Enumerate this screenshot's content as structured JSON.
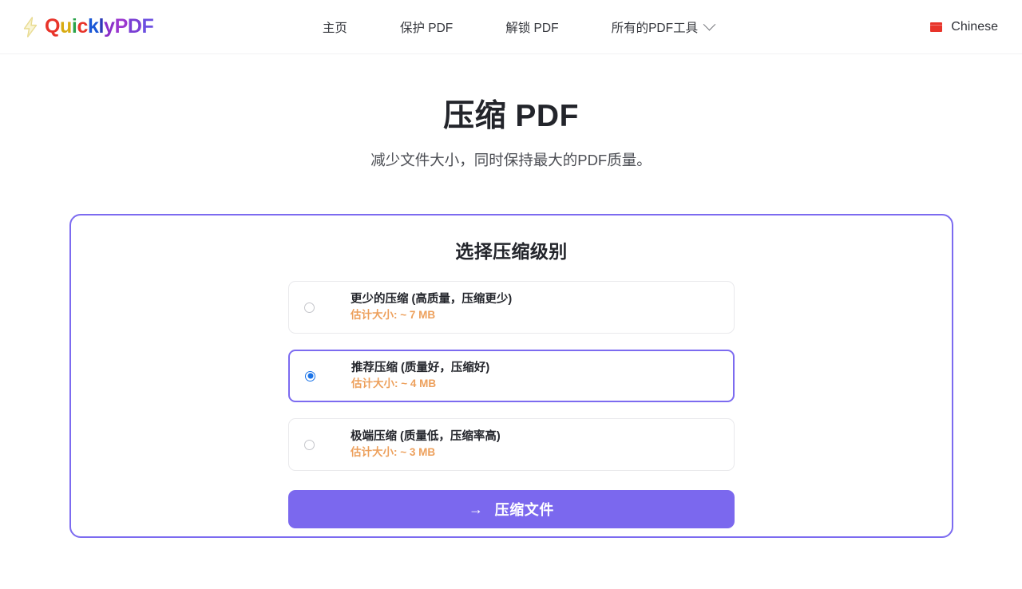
{
  "header": {
    "brand": {
      "icon": "lightning-bolt-icon",
      "letters": [
        {
          "ch": "Q",
          "cls": "l-q"
        },
        {
          "ch": "u",
          "cls": "l-u"
        },
        {
          "ch": "i",
          "cls": "l-i"
        },
        {
          "ch": "c",
          "cls": "l-c"
        },
        {
          "ch": "k",
          "cls": "l-k"
        },
        {
          "ch": "l",
          "cls": "l-l"
        },
        {
          "ch": "y",
          "cls": "l-y"
        },
        {
          "ch": "P",
          "cls": "l-p"
        },
        {
          "ch": "D",
          "cls": "l-d"
        },
        {
          "ch": "F",
          "cls": "l-f"
        }
      ],
      "full_text": "QuicklyPDF"
    },
    "nav": [
      {
        "label": "主页",
        "has_chevron": false
      },
      {
        "label": "保护 PDF",
        "has_chevron": false
      },
      {
        "label": "解锁 PDF",
        "has_chevron": false
      },
      {
        "label": "所有的PDF工具",
        "has_chevron": true
      }
    ],
    "language": {
      "label": "Chinese",
      "flag_icon": "china-flag-icon",
      "flag_color": "#e8342a"
    }
  },
  "hero": {
    "title": "压缩 PDF",
    "subtitle": "减少文件大小，同时保持最大的PDF质量。"
  },
  "card": {
    "title": "选择压缩级别",
    "accent_color": "#7b68ee",
    "options": [
      {
        "label": "更少的压缩 (高质量，压缩更少)",
        "size": "估计大小: ~ 7 MB",
        "selected": false
      },
      {
        "label": "推荐压缩 (质量好，压缩好)",
        "size": "估计大小: ~ 4 MB",
        "selected": true
      },
      {
        "label": "极端压缩 (质量低，压缩率高)",
        "size": "估计大小: ~ 3 MB",
        "selected": false
      }
    ],
    "submit": {
      "arrow": "→",
      "label": "压缩文件"
    }
  }
}
